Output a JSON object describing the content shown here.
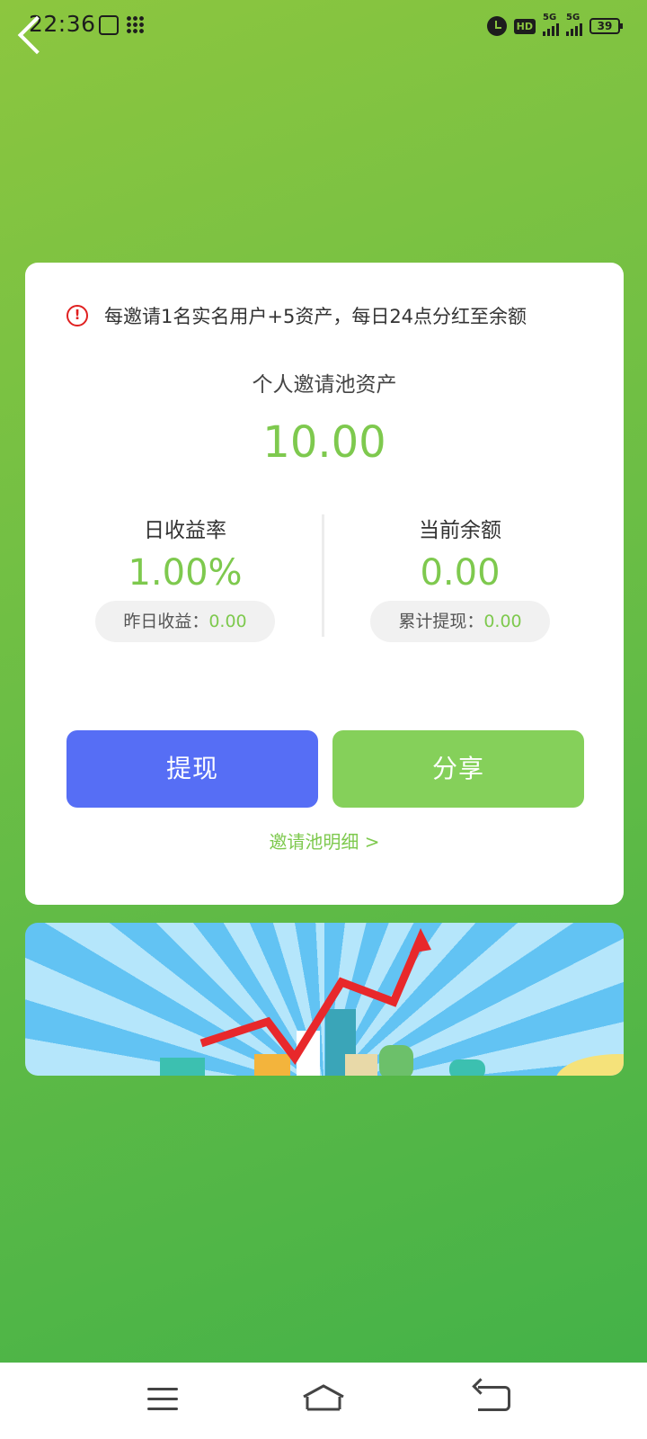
{
  "status_bar": {
    "time": "22:36",
    "network_1": "5G",
    "network_2": "5G",
    "hd": "HD",
    "battery": "39"
  },
  "notice": {
    "icon": "alert-icon",
    "text": "每邀请1名实名用户+5资产，每日24点分红至余额"
  },
  "pool": {
    "title": "个人邀请池资产",
    "amount": "10.00"
  },
  "left_stat": {
    "label": "日收益率",
    "value": "1.00%",
    "pill_label": "昨日收益：",
    "pill_value": "0.00"
  },
  "right_stat": {
    "label": "当前余额",
    "value": "0.00",
    "pill_label": "累计提现：",
    "pill_value": "0.00"
  },
  "buttons": {
    "withdraw": "提现",
    "share": "分享"
  },
  "detail_link": "邀请池明细 >",
  "colors": {
    "accent_green": "#7ec94e",
    "withdraw_blue": "#566ef5",
    "share_green": "#85d05a",
    "alert_red": "#e02020"
  }
}
